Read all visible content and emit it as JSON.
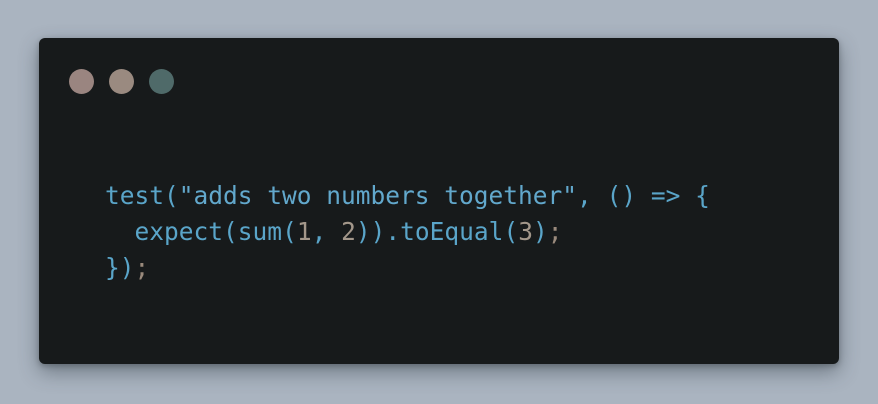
{
  "colors": {
    "background": "#aab4c0",
    "window": "#171a1b",
    "dot_1": "#9a8580",
    "dot_2": "#9a8a80",
    "dot_3": "#4f6a69",
    "code_main": "#5aa5c9",
    "code_string": "#62a8cc",
    "code_punct": "#9a8a7c",
    "code_number": "#a3978a"
  },
  "window_controls": [
    {
      "name": "window-dot-1"
    },
    {
      "name": "window-dot-2"
    },
    {
      "name": "window-dot-3"
    }
  ],
  "code": {
    "lines": [
      [
        {
          "t": "test",
          "c": "code_main"
        },
        {
          "t": "(",
          "c": "code_main"
        },
        {
          "t": "\"adds two numbers together\"",
          "c": "code_string"
        },
        {
          "t": ",",
          "c": "code_main"
        },
        {
          "t": " ",
          "c": "code_main"
        },
        {
          "t": "()",
          "c": "code_main"
        },
        {
          "t": " ",
          "c": "code_main"
        },
        {
          "t": "=>",
          "c": "code_main"
        },
        {
          "t": " ",
          "c": "code_main"
        },
        {
          "t": "{",
          "c": "code_main"
        }
      ],
      [
        {
          "t": "  ",
          "c": "code_main"
        },
        {
          "t": "expect",
          "c": "code_main"
        },
        {
          "t": "(",
          "c": "code_main"
        },
        {
          "t": "sum",
          "c": "code_main"
        },
        {
          "t": "(",
          "c": "code_main"
        },
        {
          "t": "1",
          "c": "code_number"
        },
        {
          "t": ",",
          "c": "code_main"
        },
        {
          "t": " ",
          "c": "code_main"
        },
        {
          "t": "2",
          "c": "code_number"
        },
        {
          "t": "))",
          "c": "code_main"
        },
        {
          "t": ".",
          "c": "code_main"
        },
        {
          "t": "toEqual",
          "c": "code_main"
        },
        {
          "t": "(",
          "c": "code_main"
        },
        {
          "t": "3",
          "c": "code_number"
        },
        {
          "t": ")",
          "c": "code_main"
        },
        {
          "t": ";",
          "c": "code_punct"
        }
      ],
      [
        {
          "t": "}",
          "c": "code_main"
        },
        {
          "t": ")",
          "c": "code_main"
        },
        {
          "t": ";",
          "c": "code_punct"
        }
      ]
    ]
  }
}
